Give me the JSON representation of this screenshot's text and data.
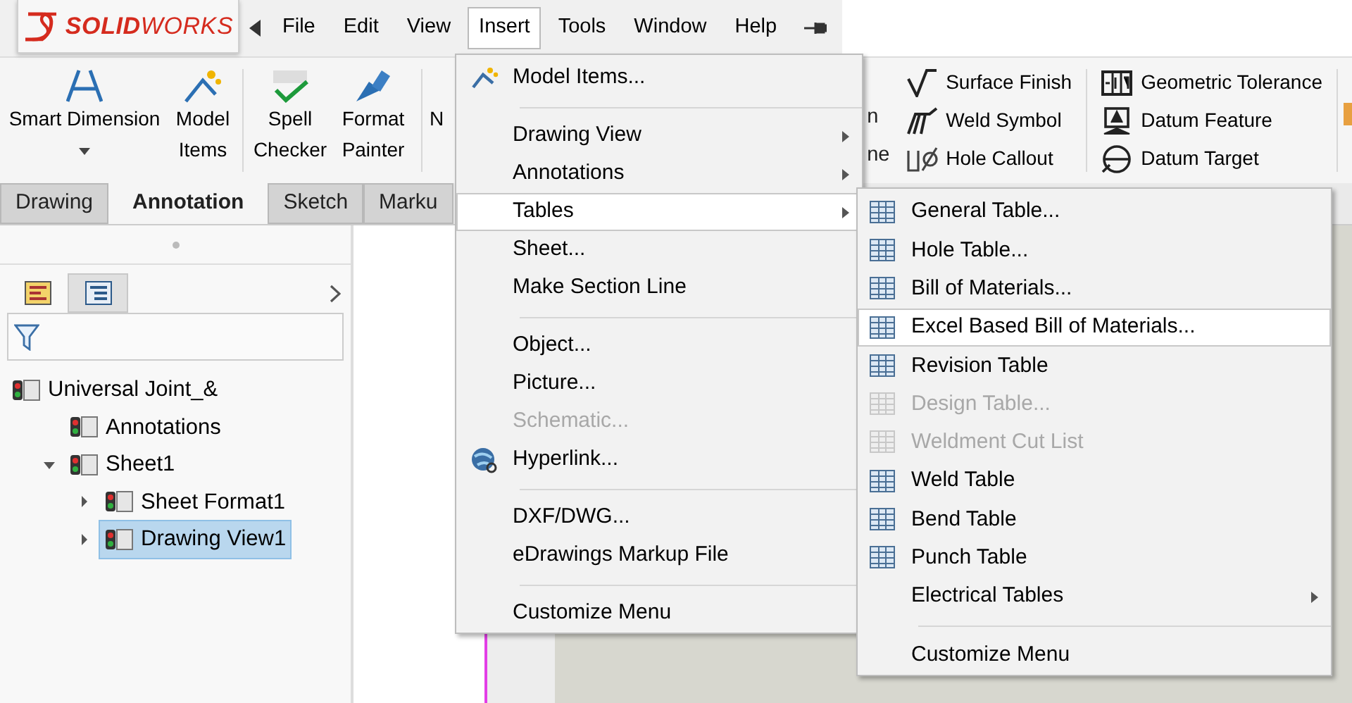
{
  "app": {
    "logo": "**SOLID**WORKS"
  },
  "menu_bar": {
    "items": [
      {
        "label": "File",
        "selected": false
      },
      {
        "label": "Edit",
        "selected": false
      },
      {
        "label": "View",
        "selected": false
      },
      {
        "label": "Insert",
        "selected": true
      },
      {
        "label": "Tools",
        "selected": false
      },
      {
        "label": "Window",
        "selected": false
      },
      {
        "label": "Help",
        "selected": false
      }
    ]
  },
  "ribbon": {
    "large_button_groups": [
      [
        {
          "label": "Smart Dimension",
          "has_dropdown": true
        },
        {
          "label": "Model Items",
          "has_dropdown": false
        }
      ],
      [
        {
          "label": "Spell Checker",
          "has_dropdown": false
        },
        {
          "label": "Format Painter",
          "has_dropdown": false
        }
      ],
      [
        {
          "label": "N",
          "has_dropdown": false
        }
      ]
    ],
    "partial_labels": [
      "n",
      "ne"
    ],
    "small_button_columns": [
      [
        {
          "label": "Surface Finish"
        },
        {
          "label": "Weld Symbol"
        },
        {
          "label": "Hole Callout"
        }
      ],
      [
        {
          "label": "Geometric Tolerance"
        },
        {
          "label": "Datum Feature"
        },
        {
          "label": "Datum Target"
        }
      ]
    ]
  },
  "tabs": [
    {
      "label": "Drawing",
      "selected": false
    },
    {
      "label": "Annotation",
      "selected": true
    },
    {
      "label": "Sketch",
      "selected": false
    },
    {
      "label": "Marku",
      "selected": false
    }
  ],
  "feature_manager": {
    "panel_tabs": [
      {
        "selected": false
      },
      {
        "selected": true
      }
    ],
    "tree": [
      {
        "label": "Universal Joint_&",
        "selected": false,
        "children": [
          {
            "label": "Annotations",
            "selected": false
          },
          {
            "label": "Sheet1",
            "expanded": true,
            "selected": false,
            "children": [
              {
                "label": "Sheet Format1",
                "expanded": false,
                "selected": false
              },
              {
                "label": "Drawing View1",
                "expanded": false,
                "selected": true
              }
            ]
          }
        ]
      }
    ]
  },
  "insert_menu": {
    "items": [
      {
        "kind": "item",
        "label": "Model Items...",
        "has_icon": true,
        "has_submenu": false,
        "disabled": false,
        "selected": false
      },
      {
        "kind": "separator"
      },
      {
        "kind": "item",
        "label": "Drawing View",
        "has_icon": false,
        "has_submenu": true,
        "disabled": false,
        "selected": false
      },
      {
        "kind": "item",
        "label": "Annotations",
        "has_icon": false,
        "has_submenu": true,
        "disabled": false,
        "selected": false
      },
      {
        "kind": "item",
        "label": "Tables",
        "has_icon": false,
        "has_submenu": true,
        "disabled": false,
        "selected": true
      },
      {
        "kind": "item",
        "label": "Sheet...",
        "has_icon": false,
        "has_submenu": false,
        "disabled": false,
        "selected": false
      },
      {
        "kind": "item",
        "label": "Make Section Line",
        "has_icon": false,
        "has_submenu": false,
        "disabled": false,
        "selected": false
      },
      {
        "kind": "separator"
      },
      {
        "kind": "item",
        "label": "Object...",
        "has_icon": false,
        "has_submenu": false,
        "disabled": false,
        "selected": false
      },
      {
        "kind": "item",
        "label": "Picture...",
        "has_icon": false,
        "has_submenu": false,
        "disabled": false,
        "selected": false
      },
      {
        "kind": "item",
        "label": "Schematic...",
        "has_icon": false,
        "has_submenu": false,
        "disabled": true,
        "selected": false
      },
      {
        "kind": "item",
        "label": "Hyperlink...",
        "has_icon": true,
        "has_submenu": false,
        "disabled": false,
        "selected": false
      },
      {
        "kind": "separator"
      },
      {
        "kind": "item",
        "label": "DXF/DWG...",
        "has_icon": false,
        "has_submenu": false,
        "disabled": false,
        "selected": false
      },
      {
        "kind": "item",
        "label": "eDrawings Markup File",
        "has_icon": false,
        "has_submenu": false,
        "disabled": false,
        "selected": false
      },
      {
        "kind": "separator"
      },
      {
        "kind": "item",
        "label": "Customize Menu",
        "has_icon": false,
        "has_submenu": false,
        "disabled": false,
        "selected": false
      }
    ]
  },
  "tables_submenu": {
    "items": [
      {
        "kind": "item",
        "label": "General Table...",
        "has_icon": true,
        "has_submenu": false,
        "disabled": false,
        "selected": false
      },
      {
        "kind": "item",
        "label": "Hole Table...",
        "has_icon": true,
        "has_submenu": false,
        "disabled": false,
        "selected": false
      },
      {
        "kind": "item",
        "label": "Bill of Materials...",
        "has_icon": true,
        "has_submenu": false,
        "disabled": false,
        "selected": false
      },
      {
        "kind": "item",
        "label": "Excel Based Bill of Materials...",
        "has_icon": true,
        "has_submenu": false,
        "disabled": false,
        "selected": true
      },
      {
        "kind": "item",
        "label": "Revision Table",
        "has_icon": true,
        "has_submenu": false,
        "disabled": false,
        "selected": false
      },
      {
        "kind": "item",
        "label": "Design Table...",
        "has_icon": true,
        "has_submenu": false,
        "disabled": true,
        "selected": false
      },
      {
        "kind": "item",
        "label": "Weldment Cut List",
        "has_icon": true,
        "has_submenu": false,
        "disabled": true,
        "selected": false
      },
      {
        "kind": "item",
        "label": "Weld Table",
        "has_icon": true,
        "has_submenu": false,
        "disabled": false,
        "selected": false
      },
      {
        "kind": "item",
        "label": "Bend Table",
        "has_icon": true,
        "has_submenu": false,
        "disabled": false,
        "selected": false
      },
      {
        "kind": "item",
        "label": "Punch Table",
        "has_icon": true,
        "has_submenu": false,
        "disabled": false,
        "selected": false
      },
      {
        "kind": "item",
        "label": "Electrical Tables",
        "has_icon": false,
        "has_submenu": true,
        "disabled": false,
        "selected": false
      },
      {
        "kind": "separator"
      },
      {
        "kind": "item",
        "label": "Customize Menu",
        "has_icon": false,
        "has_submenu": false,
        "disabled": false,
        "selected": false
      }
    ]
  }
}
